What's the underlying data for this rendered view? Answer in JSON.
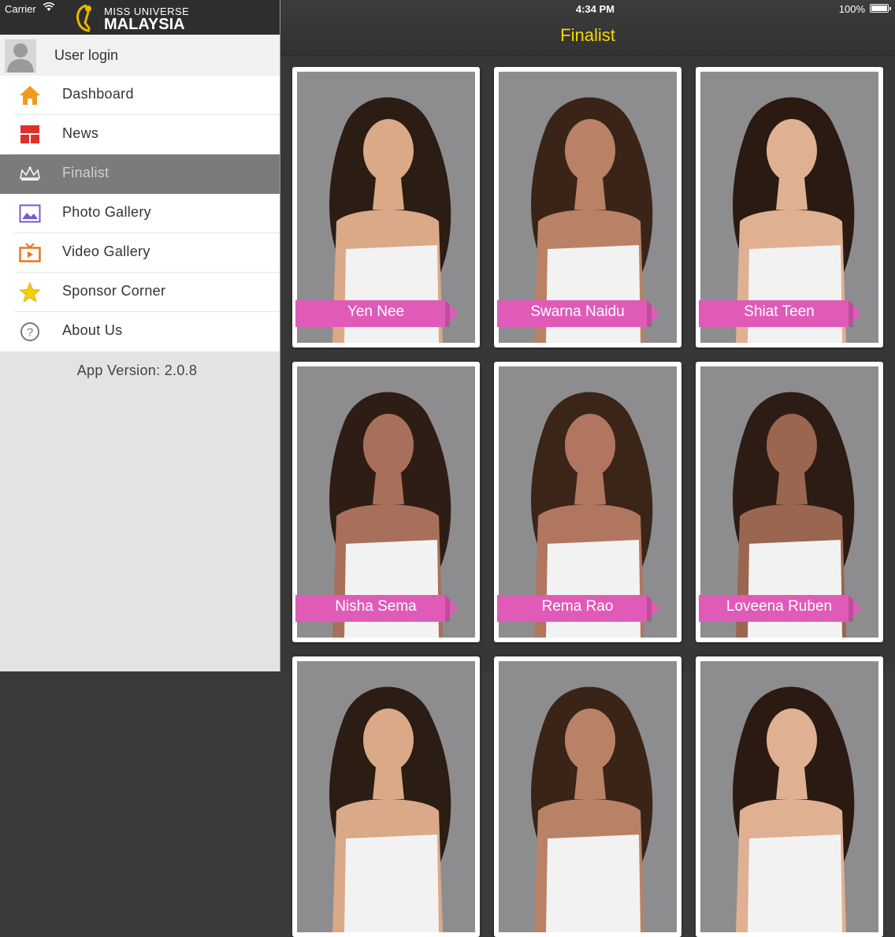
{
  "status": {
    "carrier": "Carrier",
    "time": "4:34 PM",
    "battery": "100%"
  },
  "brand": {
    "line1": "MISS UNIVERSE",
    "line2": "MALAYSIA"
  },
  "sidebar": {
    "user_login": "User login",
    "items": [
      {
        "label": "Dashboard",
        "icon": "home-icon",
        "color": "#f29a1d"
      },
      {
        "label": "News",
        "icon": "news-icon",
        "color": "#e0302a"
      },
      {
        "label": "Finalist",
        "icon": "crown-icon",
        "color": "#ffffff",
        "active": true
      },
      {
        "label": "Photo Gallery",
        "icon": "photo-icon",
        "color": "#7a5ac8"
      },
      {
        "label": "Video Gallery",
        "icon": "tv-icon",
        "color": "#e8711a"
      },
      {
        "label": "Sponsor Corner",
        "icon": "star-icon",
        "color": "#f5d000"
      },
      {
        "label": "About Us",
        "icon": "help-icon",
        "color": "#777777"
      }
    ],
    "app_version": "App Version: 2.0.8"
  },
  "main": {
    "title": "Finalist",
    "accent": "#f5d800",
    "ribbon_color": "#e05bb8",
    "finalists": [
      {
        "name": "Yen Nee"
      },
      {
        "name": "Swarna Naidu"
      },
      {
        "name": "Shiat Teen"
      },
      {
        "name": "Nisha Sema"
      },
      {
        "name": "Rema Rao"
      },
      {
        "name": "Loveena Ruben"
      }
    ]
  }
}
